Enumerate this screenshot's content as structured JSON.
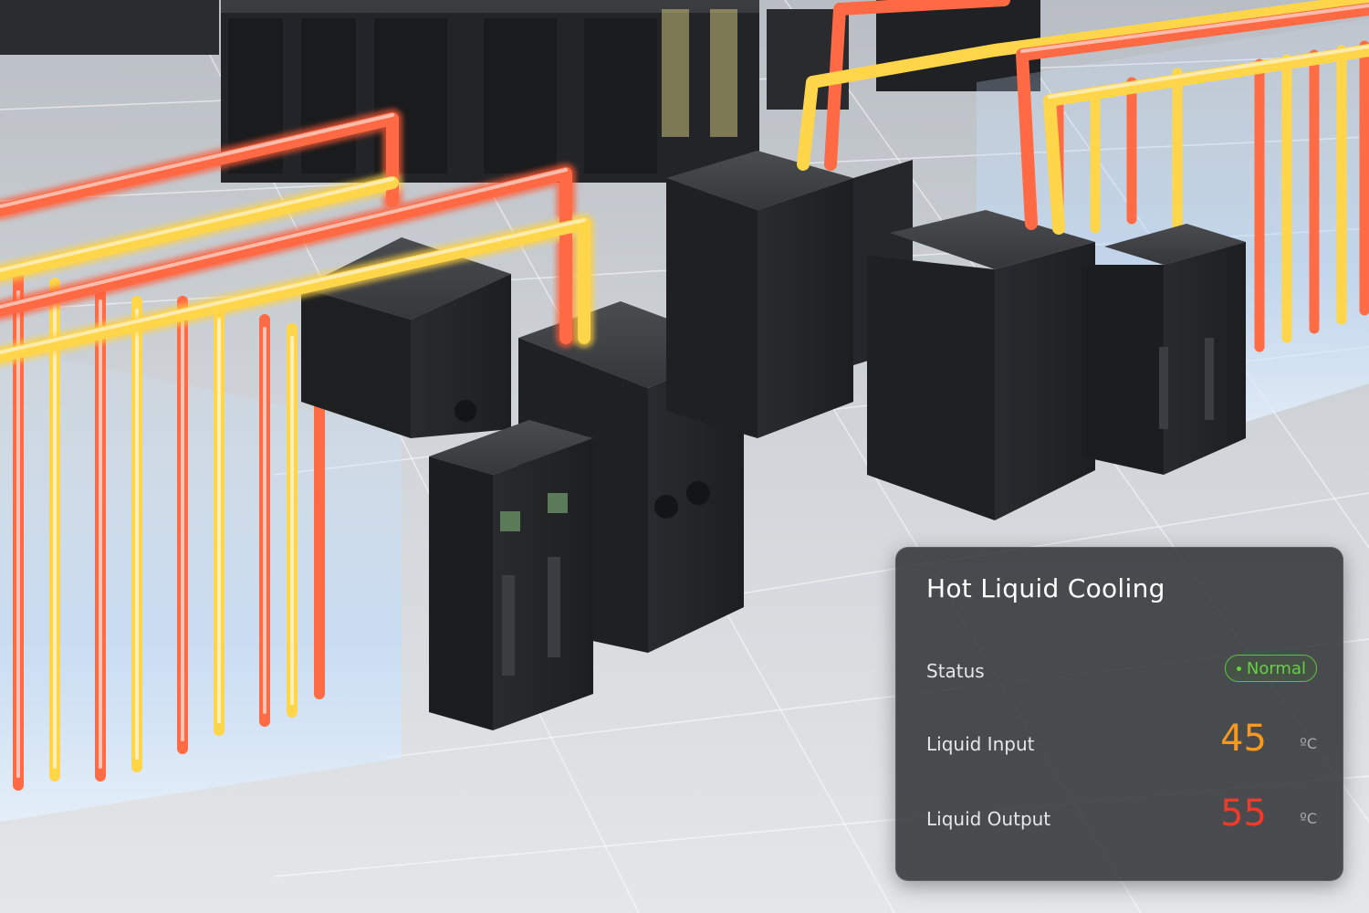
{
  "panel": {
    "title": "Hot Liquid Cooling",
    "status": {
      "label": "Status",
      "value": "Normal",
      "color": "#66cf45"
    },
    "liquid_input": {
      "label": "Liquid Input",
      "value": "45",
      "unit": "ºC",
      "color": "#f59a1e"
    },
    "liquid_output": {
      "label": "Liquid Output",
      "value": "55",
      "unit": "ºC",
      "color": "#ee3b2b"
    }
  },
  "icons": {
    "status_dot": "status-dot-icon"
  }
}
